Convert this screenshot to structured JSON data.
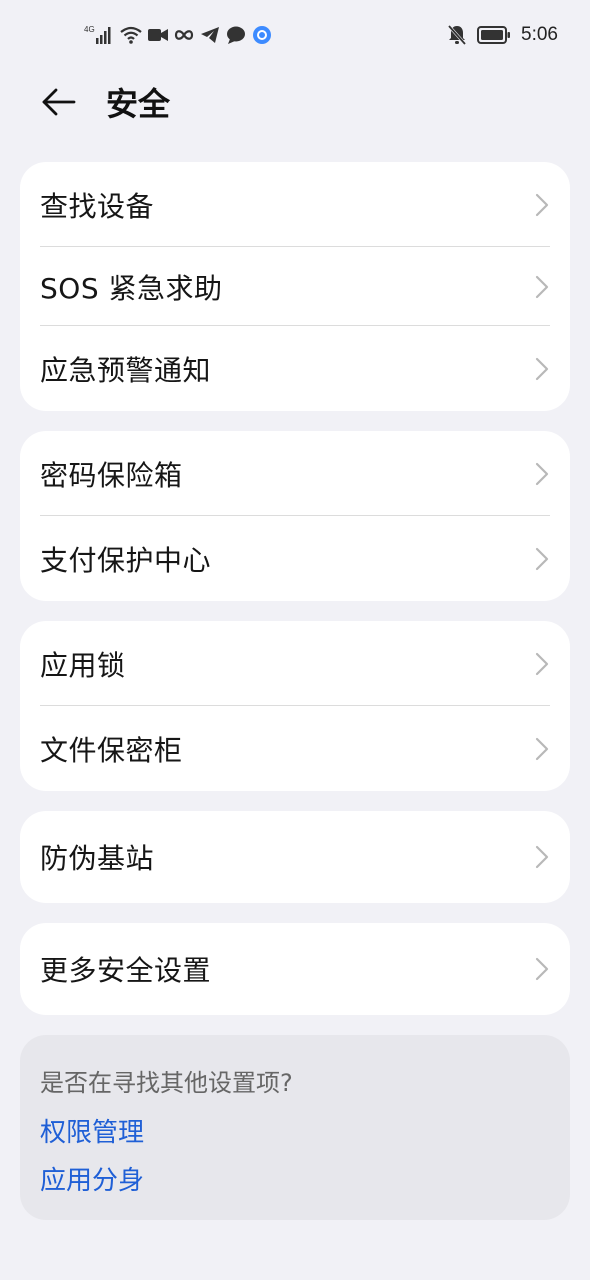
{
  "status_bar": {
    "network_label": "4G",
    "time": "5:06",
    "icons_left": [
      "signal-icon",
      "wifi-icon",
      "video-icon",
      "infinity-icon",
      "telegram-icon",
      "chat-icon",
      "browser-icon"
    ],
    "icons_right": [
      "bell-off-icon",
      "battery-icon"
    ]
  },
  "header": {
    "title": "安全"
  },
  "groups": [
    {
      "items": [
        {
          "label": "查找设备"
        },
        {
          "label": "SOS 紧急求助"
        },
        {
          "label": "应急预警通知"
        }
      ]
    },
    {
      "items": [
        {
          "label": "密码保险箱"
        },
        {
          "label": "支付保护中心"
        }
      ]
    },
    {
      "items": [
        {
          "label": "应用锁"
        },
        {
          "label": "文件保密柜"
        }
      ]
    },
    {
      "items": [
        {
          "label": "防伪基站"
        }
      ]
    },
    {
      "items": [
        {
          "label": "更多安全设置"
        }
      ]
    }
  ],
  "suggestions": {
    "question": "是否在寻找其他设置项?",
    "links": [
      {
        "label": "权限管理"
      },
      {
        "label": "应用分身"
      }
    ]
  },
  "colors": {
    "background": "#f1f1f6",
    "card": "#ffffff",
    "suggest_bg": "#e7e7ec",
    "link": "#1f5fd6"
  }
}
